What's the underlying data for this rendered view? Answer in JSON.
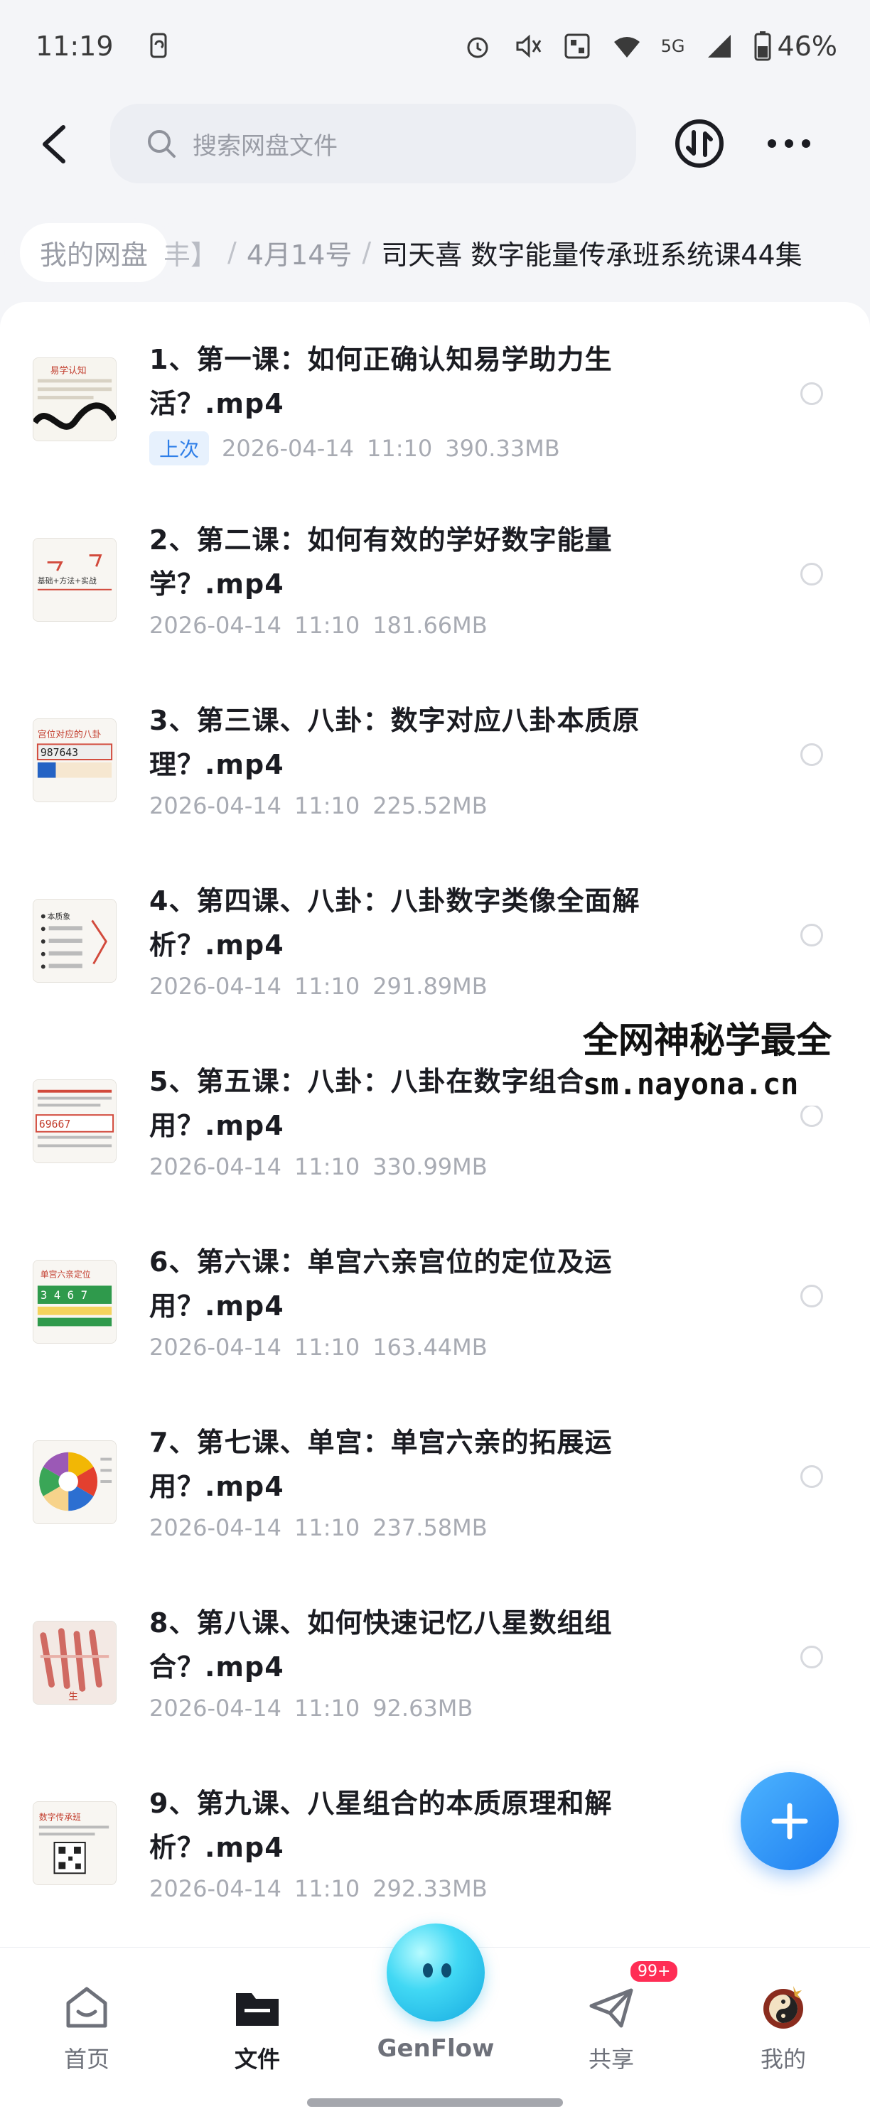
{
  "status_bar": {
    "time": "11:19",
    "signal_label": "5G",
    "battery": "46%"
  },
  "header": {
    "search_placeholder": "搜索网盘文件"
  },
  "breadcrumb": {
    "root": "我的网盘",
    "fragment": "丰】",
    "folder": "4月14号",
    "current": "司天喜 数字能量传承班系统课44集"
  },
  "files": [
    {
      "title": "1、第一课：如何正确认知易学助力生活？.mp4",
      "last_tag": "上次",
      "date": "2026-04-14",
      "time": "11:10",
      "size": "390.33MB",
      "thumb_text": "易学认知"
    },
    {
      "title": "2、第二课：如何有效的学好数字能量学？.mp4",
      "date": "2026-04-14",
      "time": "11:10",
      "size": "181.66MB",
      "thumb_text": "基础+方法+实战"
    },
    {
      "title": "3、第三课、八卦：数字对应八卦本质原理？.mp4",
      "date": "2026-04-14",
      "time": "11:10",
      "size": "225.52MB",
      "thumb_text": "宫位对应的八卦"
    },
    {
      "title": "4、第四课、八卦：八卦数字类像全面解析？.mp4",
      "date": "2026-04-14",
      "time": "11:10",
      "size": "291.89MB",
      "thumb_text": "本质象"
    },
    {
      "title": "5、第五课：八卦：八卦在数字组合运用？.mp4",
      "date": "2026-04-14",
      "time": "11:10",
      "size": "330.99MB",
      "thumb_text": "69667"
    },
    {
      "title": "6、第六课：单宫六亲宫位的定位及运用？.mp4",
      "date": "2026-04-14",
      "time": "11:10",
      "size": "163.44MB",
      "thumb_text": "单宫六亲定位"
    },
    {
      "title": "7、第七课、单宫：单宫六亲的拓展运用？.mp4",
      "date": "2026-04-14",
      "time": "11:10",
      "size": "237.58MB",
      "thumb_text": ""
    },
    {
      "title": "8、第八课、如何快速记忆八星数组组合？.mp4",
      "date": "2026-04-14",
      "time": "11:10",
      "size": "92.63MB",
      "thumb_text": "生"
    },
    {
      "title": "9、第九课、八星组合的本质原理和解析？.mp4",
      "date": "2026-04-14",
      "time": "11:10",
      "size": "292.33MB",
      "thumb_text": "数字传承班"
    }
  ],
  "watermark": {
    "line1": "全网神秘学最全",
    "line2": "sm.nayona.cn"
  },
  "bottom_nav": {
    "home": "首页",
    "files": "文件",
    "genflow": "GenFlow",
    "share": "共享",
    "share_badge": "99+",
    "mine": "我的"
  },
  "colors": {
    "accent": "#2f7fe8",
    "badge": "#ff2d55",
    "fab": "#1e7ef0"
  }
}
